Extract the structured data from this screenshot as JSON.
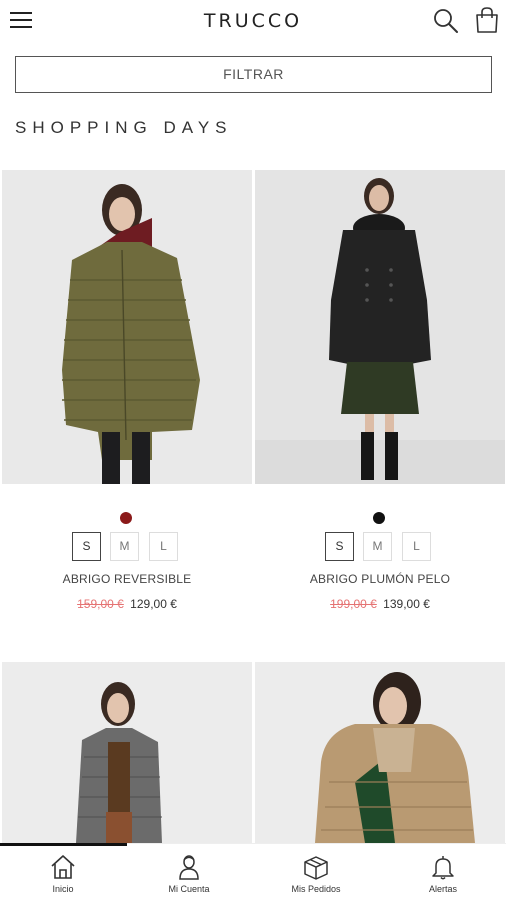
{
  "header": {
    "brand": "TRUCCO",
    "menu_icon": "hamburger-menu-icon",
    "search_icon": "search-icon",
    "bag_icon": "shopping-bag-icon"
  },
  "filter": {
    "label": "FILTRAR"
  },
  "section": {
    "title": "SHOPPING DAYS"
  },
  "products": [
    {
      "name": "ABRIGO REVERSIBLE",
      "old_price": "159,00 €",
      "price": "129,00 €",
      "color": "#8b1a1a",
      "sizes": [
        "S",
        "M",
        "L"
      ],
      "selected_size": "S"
    },
    {
      "name": "ABRIGO PLUMÓN PELO",
      "old_price": "199,00 €",
      "price": "139,00 €",
      "color": "#111111",
      "sizes": [
        "S",
        "M",
        "L"
      ],
      "selected_size": "S"
    },
    {
      "name": "",
      "old_price": "",
      "price": ""
    },
    {
      "name": "",
      "old_price": "",
      "price": ""
    }
  ],
  "bottom_nav": [
    {
      "label": "Inicio",
      "icon": "home-icon",
      "active": true
    },
    {
      "label": "Mi Cuenta",
      "icon": "user-icon",
      "active": false
    },
    {
      "label": "Mis Pedidos",
      "icon": "package-icon",
      "active": false
    },
    {
      "label": "Alertas",
      "icon": "bell-icon",
      "active": false
    }
  ]
}
